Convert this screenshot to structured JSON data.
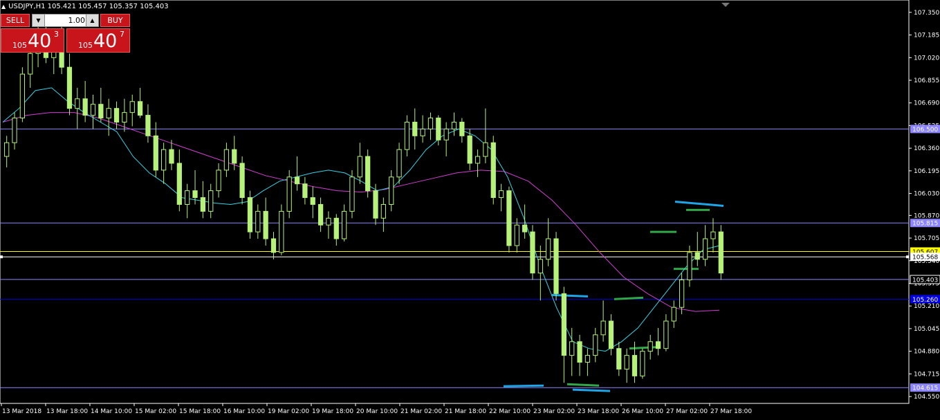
{
  "header": {
    "symbol_line": "USDJPY,H1  105.421 105.457 105.357 105.403"
  },
  "trade_panel": {
    "sell_label": "SELL",
    "buy_label": "BUY",
    "lot_value": "1.00",
    "sell_quote": {
      "small": "105",
      "big": "40",
      "sup": "3"
    },
    "buy_quote": {
      "small": "105",
      "big": "40",
      "sup": "7"
    }
  },
  "colors": {
    "background": "#000000",
    "candle": "#b6f27a",
    "ma_fast": "#38d3e6",
    "ma_slow": "#d23fd2",
    "hline": "#8c85ff",
    "support_blue": "#0000e0",
    "yellow_line": "#ffff00",
    "marker_blue": "#1ea6e8",
    "marker_green": "#30a84a",
    "axis": "#ffffff"
  },
  "chart_data": {
    "type": "candlestick",
    "symbol": "USDJPY",
    "timeframe": "H1",
    "ylim": [
      104.5,
      107.44
    ],
    "y_ticks": [
      "107.350",
      "107.185",
      "107.020",
      "106.855",
      "106.690",
      "106.525",
      "106.360",
      "106.195",
      "106.030",
      "105.870",
      "105.705",
      "105.540",
      "105.375",
      "105.210",
      "105.045",
      "104.880",
      "104.715",
      "104.550"
    ],
    "x_ticks": [
      "13 Mar 2018",
      "13 Mar 18:00",
      "14 Mar 10:00",
      "15 Mar 02:00",
      "15 Mar 18:00",
      "16 Mar 10:00",
      "19 Mar 02:00",
      "19 Mar 18:00",
      "20 Mar 10:00",
      "21 Mar 02:00",
      "21 Mar 18:00",
      "22 Mar 10:00",
      "23 Mar 02:00",
      "23 Mar 18:00",
      "26 Mar 10:00",
      "27 Mar 02:00",
      "27 Mar 18:00"
    ],
    "price_labels": [
      {
        "text": "106.500",
        "value": 106.5,
        "color": "#8c85ff"
      },
      {
        "text": "105.815",
        "value": 105.815,
        "color": "#8c85ff"
      },
      {
        "text": "105.607",
        "value": 105.607,
        "color": "#ffff00"
      },
      {
        "text": "105.568",
        "value": 105.568,
        "color": "#ffffff"
      },
      {
        "text": "105.403",
        "value": 105.403,
        "color": "#000000"
      },
      {
        "text": "105.260",
        "value": 105.26,
        "color": "#0000e0"
      },
      {
        "text": "104.615",
        "value": 104.615,
        "color": "#8c85ff"
      }
    ],
    "hlines": [
      {
        "value": 106.5,
        "color": "#8c85ff"
      },
      {
        "value": 105.815,
        "color": "#8c85ff"
      },
      {
        "value": 105.607,
        "color": "#ffff00"
      },
      {
        "value": 105.568,
        "color": "#ffffff"
      },
      {
        "value": 105.403,
        "color": "#8c85ff"
      },
      {
        "value": 105.26,
        "color": "#0000e0"
      },
      {
        "value": 104.615,
        "color": "#8c85ff"
      }
    ],
    "candles": [
      [
        106.3,
        106.45,
        106.22,
        106.4
      ],
      [
        106.4,
        106.62,
        106.35,
        106.58
      ],
      [
        106.58,
        106.95,
        106.55,
        106.9
      ],
      [
        106.9,
        107.1,
        106.8,
        107.05
      ],
      [
        107.05,
        107.25,
        106.95,
        107.12
      ],
      [
        107.12,
        107.3,
        106.98,
        107.02
      ],
      [
        107.02,
        107.2,
        106.9,
        107.15
      ],
      [
        107.15,
        107.3,
        106.9,
        106.95
      ],
      [
        106.95,
        107.05,
        106.6,
        106.65
      ],
      [
        106.65,
        106.8,
        106.5,
        106.72
      ],
      [
        106.72,
        106.85,
        106.55,
        106.6
      ],
      [
        106.6,
        106.75,
        106.5,
        106.68
      ],
      [
        106.68,
        106.8,
        106.55,
        106.58
      ],
      [
        106.58,
        106.72,
        106.45,
        106.65
      ],
      [
        106.65,
        106.7,
        106.5,
        106.55
      ],
      [
        106.55,
        106.72,
        106.48,
        106.62
      ],
      [
        106.62,
        106.75,
        106.52,
        106.7
      ],
      [
        106.7,
        106.8,
        106.58,
        106.6
      ],
      [
        106.6,
        106.68,
        106.4,
        106.45
      ],
      [
        106.45,
        106.55,
        106.15,
        106.2
      ],
      [
        106.2,
        106.4,
        106.1,
        106.35
      ],
      [
        106.35,
        106.42,
        106.2,
        106.25
      ],
      [
        106.25,
        106.35,
        105.9,
        105.95
      ],
      [
        105.95,
        106.1,
        105.85,
        106.05
      ],
      [
        106.05,
        106.2,
        105.95,
        106.0
      ],
      [
        106.0,
        106.12,
        105.85,
        105.9
      ],
      [
        105.9,
        106.1,
        105.85,
        106.05
      ],
      [
        106.05,
        106.25,
        106.0,
        106.2
      ],
      [
        106.2,
        106.4,
        106.15,
        106.35
      ],
      [
        106.35,
        106.45,
        106.2,
        106.25
      ],
      [
        106.25,
        106.3,
        105.95,
        106.0
      ],
      [
        106.0,
        106.05,
        105.7,
        105.75
      ],
      [
        105.75,
        105.95,
        105.7,
        105.9
      ],
      [
        105.9,
        106.0,
        105.65,
        105.7
      ],
      [
        105.7,
        105.75,
        105.55,
        105.6
      ],
      [
        105.6,
        105.95,
        105.58,
        105.9
      ],
      [
        105.9,
        106.2,
        105.85,
        106.15
      ],
      [
        106.15,
        106.3,
        106.05,
        106.1
      ],
      [
        106.1,
        106.15,
        105.95,
        106.0
      ],
      [
        106.0,
        106.08,
        105.85,
        105.95
      ],
      [
        105.95,
        106.0,
        105.75,
        105.8
      ],
      [
        105.8,
        105.9,
        105.7,
        105.85
      ],
      [
        105.85,
        105.88,
        105.65,
        105.7
      ],
      [
        105.7,
        105.95,
        105.68,
        105.9
      ],
      [
        105.9,
        106.2,
        105.85,
        106.15
      ],
      [
        106.15,
        106.4,
        106.1,
        106.3
      ],
      [
        106.3,
        106.35,
        106.0,
        106.05
      ],
      [
        106.05,
        106.1,
        105.8,
        105.85
      ],
      [
        105.85,
        106.0,
        105.75,
        105.95
      ],
      [
        105.95,
        106.2,
        105.9,
        106.15
      ],
      [
        106.15,
        106.4,
        106.1,
        106.35
      ],
      [
        106.35,
        106.6,
        106.3,
        106.55
      ],
      [
        106.55,
        106.65,
        106.35,
        106.45
      ],
      [
        106.45,
        106.6,
        106.4,
        106.5
      ],
      [
        106.5,
        106.62,
        106.42,
        106.58
      ],
      [
        106.58,
        106.6,
        106.38,
        106.42
      ],
      [
        106.42,
        106.55,
        106.3,
        106.5
      ],
      [
        106.5,
        106.62,
        106.45,
        106.55
      ],
      [
        106.55,
        106.58,
        106.4,
        106.45
      ],
      [
        106.45,
        106.5,
        106.2,
        106.25
      ],
      [
        106.25,
        106.35,
        106.15,
        106.3
      ],
      [
        106.3,
        106.65,
        106.25,
        106.4
      ],
      [
        106.4,
        106.45,
        105.95,
        106.0
      ],
      [
        106.0,
        106.1,
        105.9,
        106.05
      ],
      [
        106.05,
        106.08,
        105.6,
        105.65
      ],
      [
        105.65,
        105.85,
        105.6,
        105.8
      ],
      [
        105.8,
        105.95,
        105.7,
        105.75
      ],
      [
        105.75,
        105.8,
        105.4,
        105.45
      ],
      [
        105.45,
        105.65,
        105.25,
        105.55
      ],
      [
        105.55,
        105.85,
        105.5,
        105.7
      ],
      [
        105.7,
        105.75,
        105.25,
        105.3
      ],
      [
        105.3,
        105.35,
        104.65,
        104.85
      ],
      [
        104.85,
        105.05,
        104.7,
        104.95
      ],
      [
        104.95,
        105.0,
        104.7,
        104.8
      ],
      [
        104.8,
        104.9,
        104.7,
        104.85
      ],
      [
        104.85,
        105.05,
        104.8,
        105.0
      ],
      [
        105.0,
        105.25,
        104.95,
        105.1
      ],
      [
        105.1,
        105.15,
        104.85,
        104.9
      ],
      [
        104.9,
        104.95,
        104.7,
        104.75
      ],
      [
        104.75,
        104.9,
        104.65,
        104.85
      ],
      [
        104.85,
        104.95,
        104.65,
        104.7
      ],
      [
        104.7,
        104.9,
        104.68,
        104.88
      ],
      [
        104.88,
        105.0,
        104.82,
        104.95
      ],
      [
        104.95,
        105.05,
        104.85,
        104.9
      ],
      [
        104.9,
        105.15,
        104.88,
        105.1
      ],
      [
        105.1,
        105.25,
        105.05,
        105.2
      ],
      [
        105.2,
        105.45,
        105.15,
        105.4
      ],
      [
        105.4,
        105.65,
        105.35,
        105.6
      ],
      [
        105.6,
        105.75,
        105.5,
        105.55
      ],
      [
        105.55,
        105.8,
        105.5,
        105.7
      ],
      [
        105.7,
        105.85,
        105.6,
        105.75
      ],
      [
        105.75,
        105.8,
        105.4,
        105.45
      ]
    ],
    "ma_fast": [
      106.55,
      106.65,
      106.78,
      106.8,
      106.7,
      106.62,
      106.55,
      106.48,
      106.3,
      106.18,
      106.1,
      106.0,
      105.98,
      105.96,
      105.95,
      105.97,
      106.05,
      106.12,
      106.15,
      106.18,
      106.2,
      106.18,
      106.12,
      106.05,
      106.08,
      106.2,
      106.35,
      106.45,
      106.5,
      106.45,
      106.35,
      106.15,
      105.85,
      105.5,
      105.2,
      104.95,
      104.9,
      104.88,
      104.95,
      105.05,
      105.2,
      105.35,
      105.5,
      105.62,
      105.65
    ],
    "ma_slow": [
      106.55,
      106.6,
      106.62,
      106.62,
      106.58,
      106.52,
      106.46,
      106.4,
      106.34,
      106.28,
      106.22,
      106.16,
      106.12,
      106.08,
      106.05,
      106.04,
      106.06,
      106.1,
      106.14,
      106.18,
      106.2,
      106.19,
      106.12,
      105.98,
      105.8,
      105.6,
      105.42,
      105.3,
      105.2,
      105.17,
      105.18
    ]
  }
}
